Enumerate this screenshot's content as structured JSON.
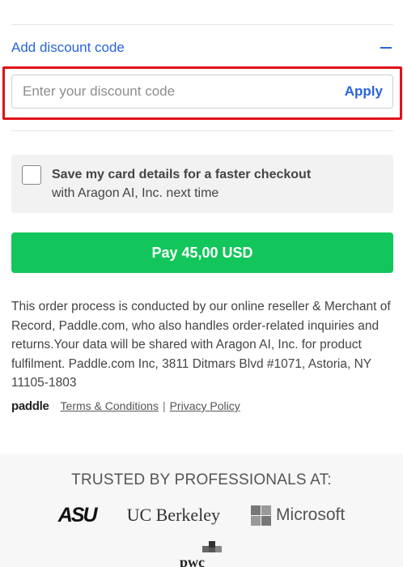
{
  "discount": {
    "toggle_label": "Add discount code",
    "input_placeholder": "Enter your discount code",
    "input_value": "",
    "apply_label": "Apply"
  },
  "save_card": {
    "title": "Save my card details for a faster checkout",
    "subtitle": "with Aragon AI, Inc. next time",
    "checked": false
  },
  "pay": {
    "label": "Pay 45,00 USD",
    "color": "#12c65c"
  },
  "legal": {
    "text": "This order process is conducted by our online reseller & Merchant of Record, Paddle.com, who also handles order-related inquiries and returns.Your data will be shared with Aragon AI, Inc. for product fulfilment. Paddle.com Inc, 3811 Ditmars Blvd #1071, Astoria, NY 11105-1803"
  },
  "footer": {
    "brand": "paddle",
    "terms_label": "Terms & Conditions",
    "separator": "|",
    "privacy_label": "Privacy Policy"
  },
  "trusted": {
    "heading": "TRUSTED BY PROFESSIONALS AT:",
    "logos": [
      "ASU",
      "UC Berkeley",
      "Microsoft",
      "pwc"
    ]
  },
  "colors": {
    "accent": "#2b63d9",
    "highlight": "#e0101b"
  }
}
